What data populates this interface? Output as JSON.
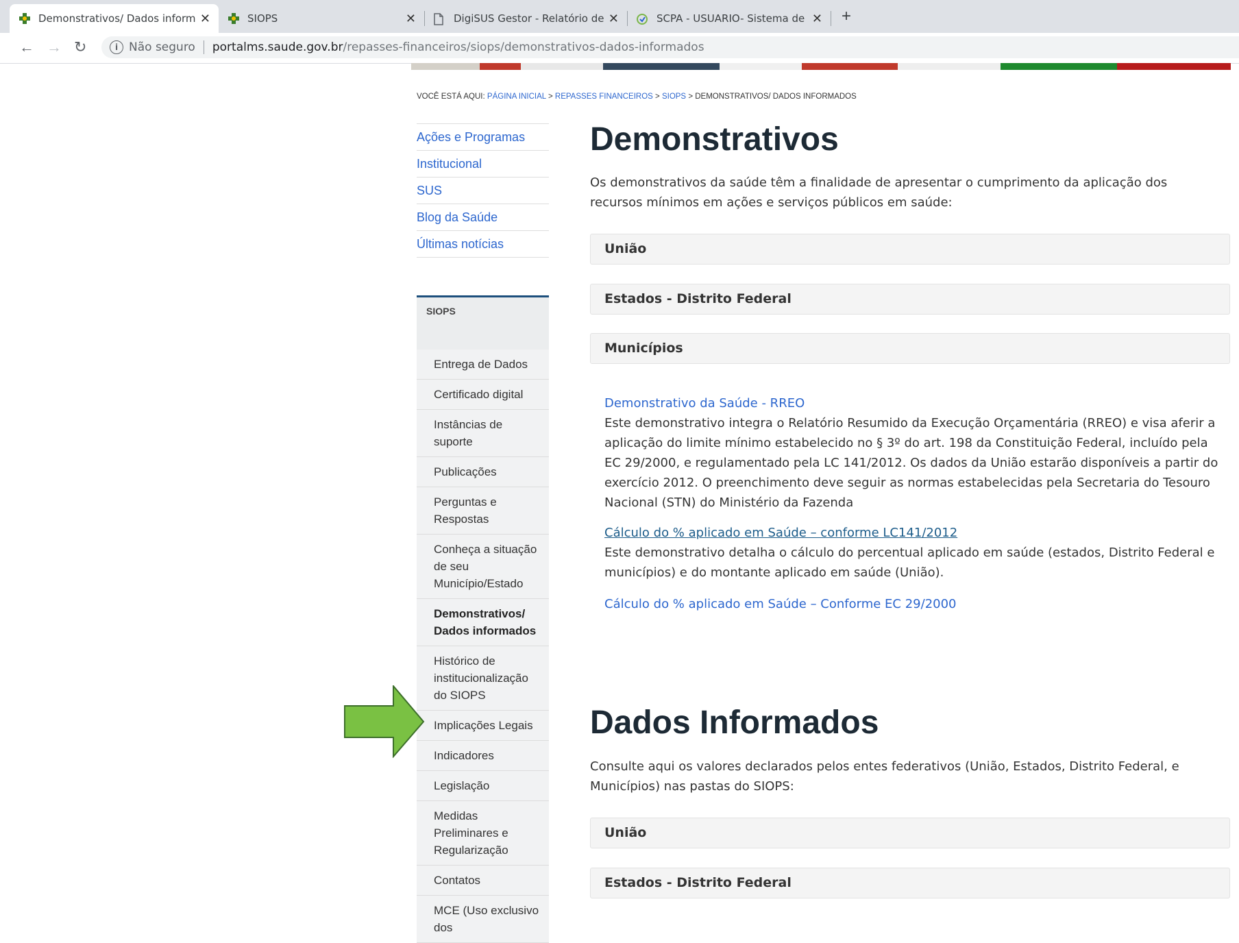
{
  "tabs": [
    {
      "title": "Demonstrativos/ Dados informad",
      "favicon": "ministry-health-icon"
    },
    {
      "title": "SIOPS",
      "favicon": "ministry-health-icon"
    },
    {
      "title": "DigiSUS Gestor - Relatório de Ge",
      "favicon": "document-icon"
    },
    {
      "title": "SCPA - USUARIO- Sistema de Ca",
      "favicon": "scpa-icon"
    }
  ],
  "address": {
    "security": "Não seguro",
    "host": "portalms.saude.gov.br",
    "path": "/repasses-financeiros/siops/demonstrativos-dados-informados"
  },
  "breadcrumb": {
    "prefix": "VOCÊ ESTÁ AQUI:",
    "links": [
      "PÁGINA INICIAL",
      "REPASSES FINANCEIROS",
      "SIOPS"
    ],
    "current": "DEMONSTRATIVOS/ DADOS INFORMADOS",
    "sep": ">"
  },
  "topnav": [
    "Ações e Programas",
    "Institucional",
    "SUS",
    "Blog da Saúde",
    "Últimas notícias"
  ],
  "siops": {
    "title": "SIOPS",
    "items": [
      "Entrega de Dados",
      "Certificado digital",
      "Instâncias de suporte",
      "Publicações",
      "Perguntas e Respostas",
      "Conheça a situação de seu Município/Estado",
      "Demonstrativos/ Dados informados",
      "Histórico de institucionalização do SIOPS",
      "Implicações Legais",
      "Indicadores",
      "Legislação",
      "Medidas Preliminares e Regularização",
      "Contatos",
      "MCE (Uso exclusivo dos"
    ]
  },
  "demonstrativos": {
    "title": "Demonstrativos",
    "intro": "Os demonstrativos da saúde têm a finalidade de apresentar o cumprimento da aplicação dos recursos mínimos em ações e serviços públicos em saúde:",
    "sections": [
      "União",
      "Estados - Distrito Federal",
      "Municípios"
    ],
    "link1": "Demonstrativo da Saúde - RREO",
    "desc1": "Este demonstrativo integra o Relatório Resumido da Execução Orçamentária (RREO) e visa aferir a aplicação do limite mínimo estabelecido no § 3º do art. 198 da Constituição Federal, incluído pela EC 29/2000, e regulamentado pela LC 141/2012. Os dados da União estarão disponíveis a partir do exercício 2012. O preenchimento deve seguir as normas estabelecidas pela Secretaria do Tesouro Nacional (STN) do Ministério da Fazenda",
    "link2": "Cálculo do % aplicado em Saúde – conforme LC141/2012",
    "desc2": "Este demonstrativo detalha o cálculo do percentual aplicado em saúde (estados, Distrito Federal e municípios) e do montante aplicado em saúde (União).",
    "link3": "Cálculo do % aplicado em Saúde – Conforme EC 29/2000"
  },
  "dados": {
    "title": "Dados Informados",
    "intro": "Consulte aqui os valores declarados pelos entes federativos (União, Estados, Distrito Federal, e Municípios) nas pastas do SIOPS:",
    "sections": [
      "União",
      "Estados - Distrito Federal"
    ]
  },
  "colors": {
    "link": "#2c66ce",
    "accent": "#1c4f7c",
    "arrow": "#7ac143"
  }
}
